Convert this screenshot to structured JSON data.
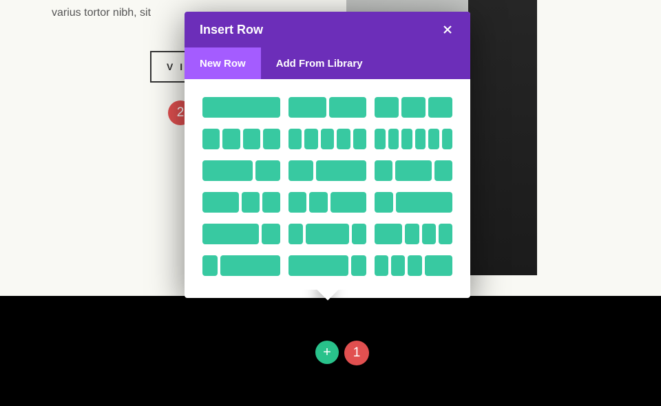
{
  "page": {
    "text_fragment": "varius tortor nibh, sit",
    "cta": "V I"
  },
  "modal": {
    "title": "Insert Row",
    "tabs": {
      "active": "New Row",
      "library": "Add From Library"
    },
    "layouts": [
      [
        1
      ],
      [
        1,
        1
      ],
      [
        1,
        1,
        1
      ],
      [
        1,
        1,
        1,
        1
      ],
      [
        1,
        1,
        1,
        1,
        1
      ],
      [
        1,
        1,
        1,
        1,
        1,
        1
      ],
      [
        2,
        1
      ],
      [
        1,
        2
      ],
      [
        1,
        2,
        1
      ],
      [
        2,
        1,
        1
      ],
      [
        1,
        1,
        2
      ],
      [
        1,
        3
      ],
      [
        3,
        1
      ],
      [
        1,
        3,
        1
      ],
      [
        2,
        1,
        1,
        1
      ],
      [
        1,
        4
      ],
      [
        4,
        1
      ],
      [
        1,
        1,
        1,
        2
      ]
    ]
  },
  "badges": {
    "add": "+",
    "step_1": "1",
    "step_2": "2"
  },
  "colors": {
    "purple": "#6c2eb9",
    "purple_light": "#a45cff",
    "teal": "#38c9a1",
    "green": "#29c28b",
    "red": "#e15050"
  }
}
